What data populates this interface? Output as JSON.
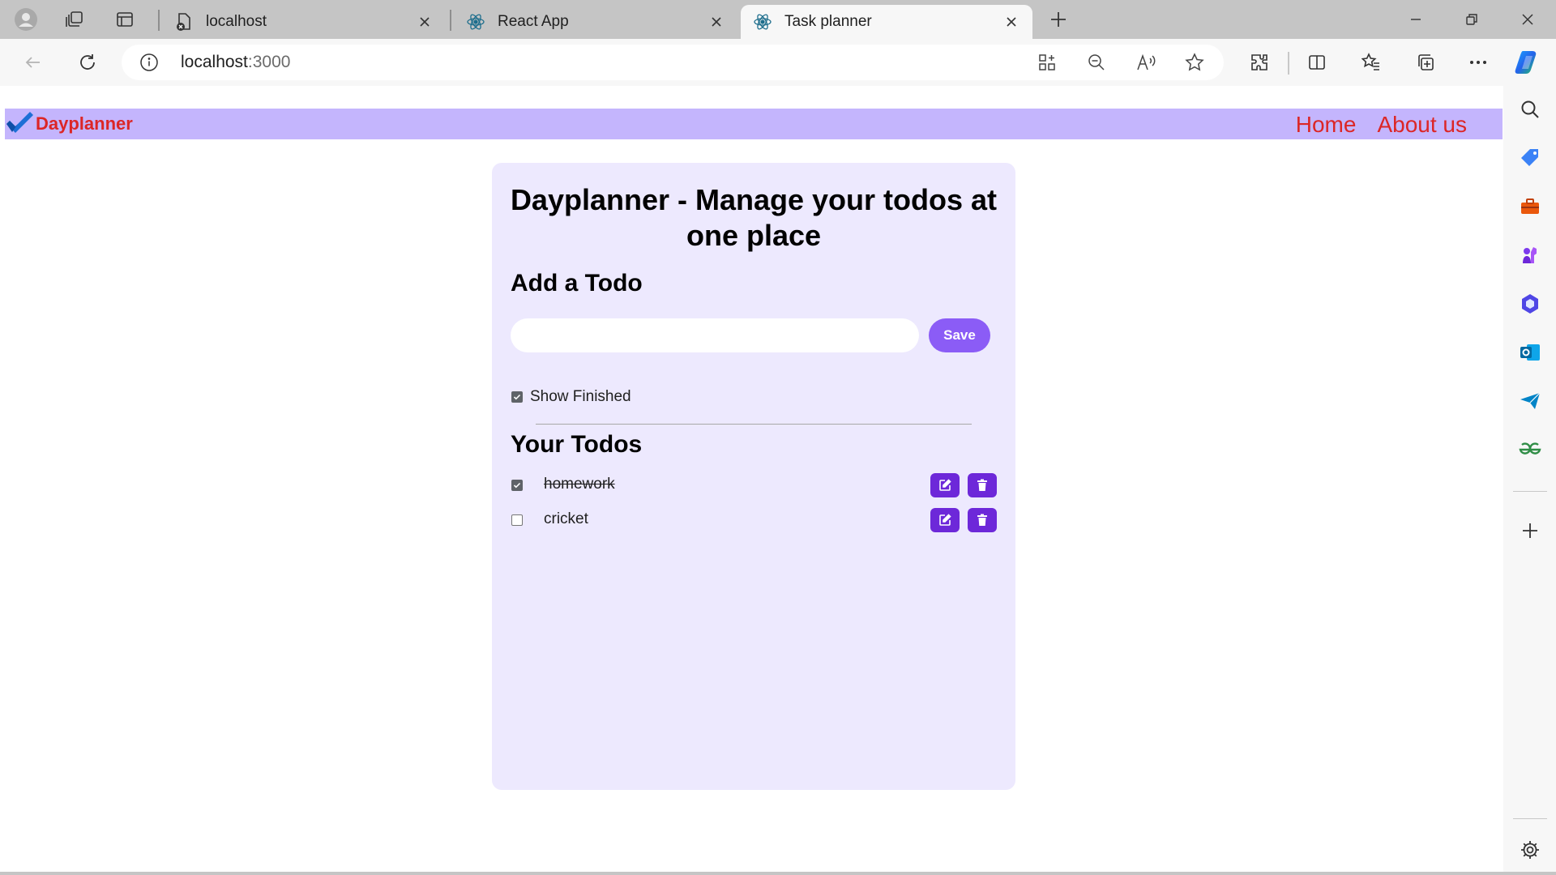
{
  "browser": {
    "tabs": [
      {
        "title": "localhost",
        "icon": "page-error-icon",
        "active": false
      },
      {
        "title": "React App",
        "icon": "react-logo-icon",
        "active": false
      },
      {
        "title": "Task planner",
        "icon": "react-logo-icon",
        "active": true
      }
    ],
    "address": {
      "host": "localhost",
      "port": ":3000"
    }
  },
  "app": {
    "brand": "Dayplanner",
    "nav": [
      "Home",
      "About us"
    ],
    "heading": "Dayplanner - Manage your todos at one place",
    "add_heading": "Add a Todo",
    "input_value": "",
    "save_label": "Save",
    "show_finished_label": "Show Finished",
    "show_finished_checked": true,
    "list_heading": "Your Todos",
    "todos": [
      {
        "text": "homework",
        "completed": true
      },
      {
        "text": "cricket",
        "completed": false
      }
    ]
  },
  "colors": {
    "navbar": "#c4b5fd",
    "brand_text": "#dc2626",
    "card": "#ede9fe",
    "save_button": "#8b5cf6",
    "icon_button": "#6d28d9"
  }
}
